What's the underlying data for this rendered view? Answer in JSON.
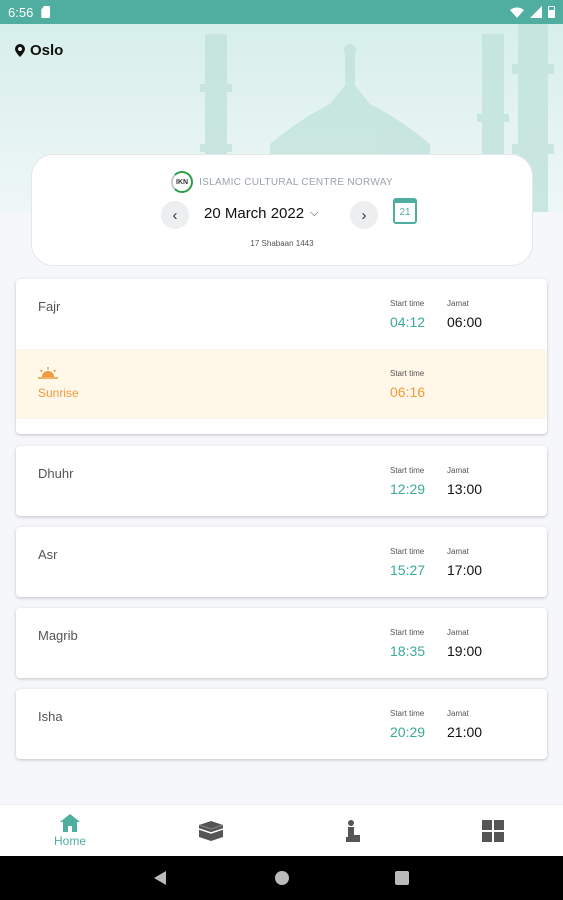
{
  "status_bar": {
    "time": "6:56"
  },
  "location": {
    "city": "Oslo"
  },
  "date_card": {
    "org_logo_text": "IKN",
    "org_name": "ISLAMIC CULTURAL CENTRE NORWAY",
    "date": "20 March 2022",
    "calendar_day": "21",
    "hijri_date": "17 Shabaan 1443"
  },
  "labels": {
    "start_time": "Start time",
    "jamat": "Jamat"
  },
  "prayers": {
    "fajr": {
      "name": "Fajr",
      "start": "04:12",
      "jamat": "06:00"
    },
    "sunrise": {
      "name": "Sunrise",
      "start": "06:16"
    },
    "dhuhr": {
      "name": "Dhuhr",
      "start": "12:29",
      "jamat": "13:00"
    },
    "asr": {
      "name": "Asr",
      "start": "15:27",
      "jamat": "17:00"
    },
    "magrib": {
      "name": "Magrib",
      "start": "18:35",
      "jamat": "19:00"
    },
    "isha": {
      "name": "Isha",
      "start": "20:29",
      "jamat": "21:00"
    }
  },
  "bottom_nav": {
    "home_label": "Home",
    "active_color": "#4fae9f",
    "items": [
      "home-icon",
      "kaaba-icon",
      "prayer-person-icon",
      "grid-icon"
    ]
  },
  "colors": {
    "accent": "#4fae9f",
    "time_teal": "#3aaa99",
    "sunrise_orange": "#f09a3e",
    "sunrise_bg": "#fff7e8"
  }
}
